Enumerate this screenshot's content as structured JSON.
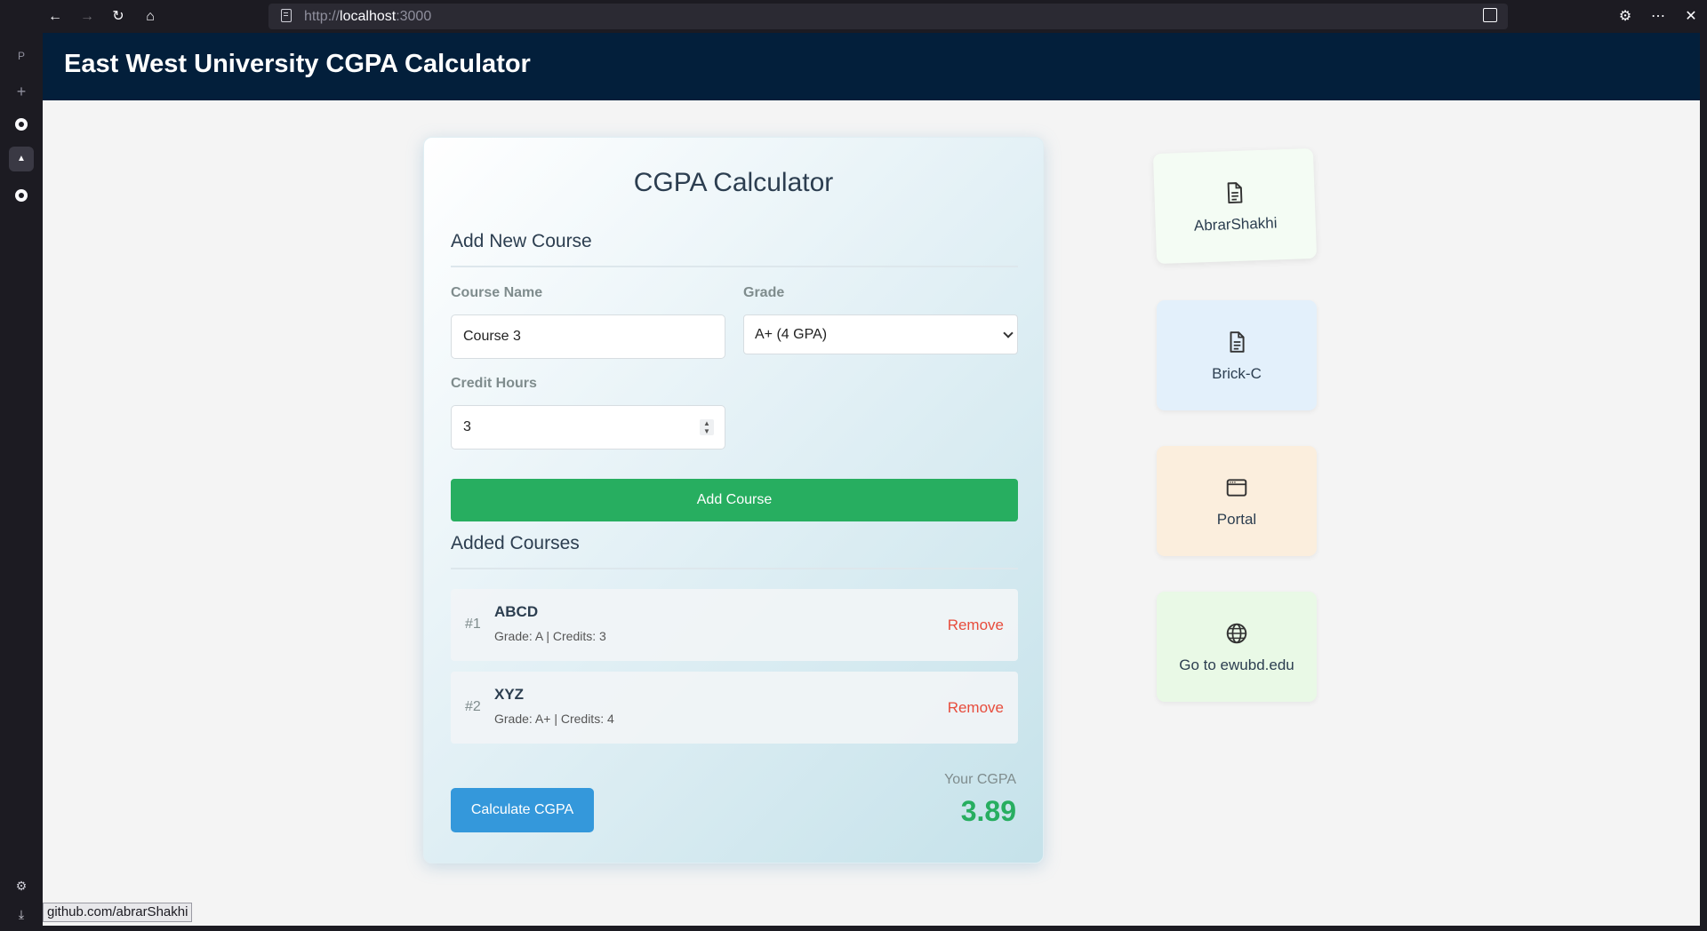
{
  "browser": {
    "url_scheme": "http://",
    "url_host": "localhost",
    "url_port": ":3000",
    "sidebar_profile_letter": "P",
    "status_link": "github.com/abrarShakhi"
  },
  "header": {
    "title": "East West University CGPA Calculator"
  },
  "calculator": {
    "title": "CGPA Calculator",
    "add_section_title": "Add New Course",
    "course_name_label": "Course Name",
    "course_name_value": "Course 3",
    "grade_label": "Grade",
    "grade_value": "A+ (4 GPA)",
    "credit_hours_label": "Credit Hours",
    "credit_hours_value": "3",
    "add_button": "Add Course",
    "added_section_title": "Added Courses",
    "courses": [
      {
        "num": "#1",
        "name": "ABCD",
        "meta": "Grade: A | Credits: 3",
        "remove": "Remove"
      },
      {
        "num": "#2",
        "name": "XYZ",
        "meta": "Grade: A+ | Credits: 4",
        "remove": "Remove"
      }
    ],
    "calc_button": "Calculate CGPA",
    "cgpa_label": "Your CGPA",
    "cgpa_value": "3.89"
  },
  "links": [
    {
      "label": "AbrarShakhi",
      "icon": "document-icon",
      "bg": "#f2fbf2"
    },
    {
      "label": "Brick-C",
      "icon": "document-icon",
      "bg": "#e3f0fb"
    },
    {
      "label": "Portal",
      "icon": "browser-window-icon",
      "bg": "#fbeedd"
    },
    {
      "label": "Go to ewubd.edu",
      "icon": "globe-icon",
      "bg": "#e9f9e6"
    }
  ],
  "colors": {
    "header_bg": "#031f3b",
    "add_button": "#27ae60",
    "calc_button": "#3498db",
    "remove_text": "#e74c3c",
    "cgpa_value": "#27ae60"
  }
}
